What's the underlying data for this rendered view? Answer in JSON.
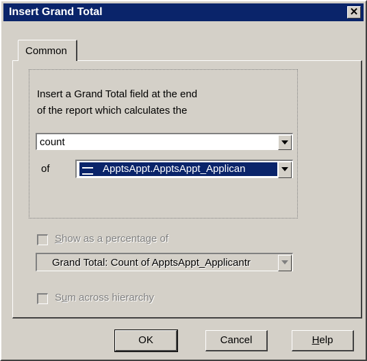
{
  "window": {
    "title": "Insert Grand Total",
    "close_glyph": "✕"
  },
  "tabs": [
    {
      "label": "Common"
    }
  ],
  "description": {
    "line1": "Insert a Grand Total field at the end",
    "line2": "of the report which calculates the"
  },
  "function_select": {
    "value": "count"
  },
  "of_label": "of",
  "field_select": {
    "value": "ApptsAppt.ApptsAppt_Applican",
    "icon": "field-icon"
  },
  "percentage": {
    "checked": false,
    "label_first": "S",
    "label_rest": "how as a percentage of",
    "select_value": "Grand Total: Count of ApptsAppt_Applicantr"
  },
  "hierarchy": {
    "checked": false,
    "label_first": "S",
    "label_underlined": "u",
    "label_rest": "m across hierarchy"
  },
  "buttons": {
    "ok": "OK",
    "cancel": "Cancel",
    "help_first": "H",
    "help_rest": "elp"
  },
  "colors": {
    "titlebar": "#0a246a",
    "face": "#d4d0c8",
    "selection": "#0a246a"
  }
}
